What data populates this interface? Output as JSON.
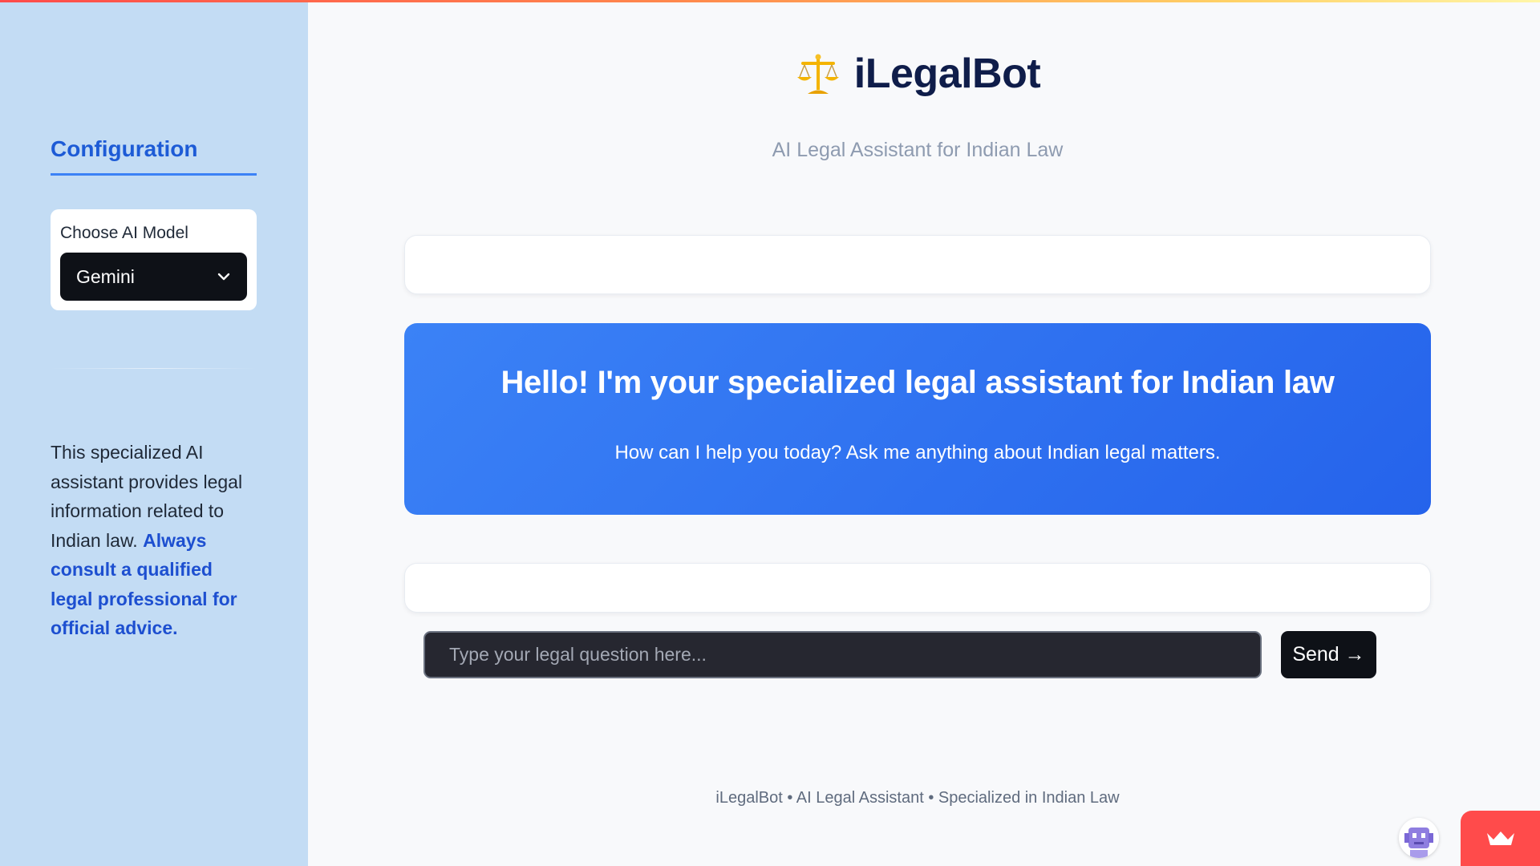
{
  "app": {
    "title": "iLegalBot",
    "subtitle": "AI Legal Assistant for Indian Law",
    "logo_icon": "balance-scale-icon"
  },
  "sidebar": {
    "heading": "Configuration",
    "model_select": {
      "label": "Choose AI Model",
      "selected": "Gemini",
      "icon": "chevron-down-icon"
    },
    "info_text": "This specialized AI assistant provides legal information related to Indian law.",
    "warning_text": "Always consult a qualified legal professional for official advice."
  },
  "welcome": {
    "title": "Hello! I'm your specialized legal assistant for Indian law",
    "subtitle": "How can I help you today? Ask me anything about Indian legal matters."
  },
  "chat_input": {
    "placeholder": "Type your legal question here...",
    "value": "",
    "send_label": "Send →"
  },
  "footer": {
    "text": "iLegalBot • AI Legal Assistant • Specialized in Indian Law"
  },
  "widgets": {
    "avatar_icon": "robot-avatar-icon",
    "badge_icon": "crown-icon"
  },
  "colors": {
    "sidebar_bg": "#c3dcf4",
    "accent": "#1d5bd6",
    "welcome_gradient_start": "#3b82f6",
    "welcome_gradient_end": "#2563eb",
    "dark_control": "#0e1117",
    "badge": "#ff4b4b"
  }
}
